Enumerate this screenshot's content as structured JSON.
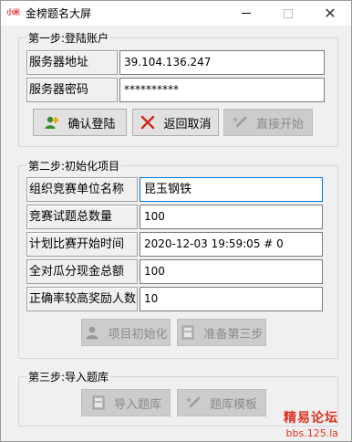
{
  "window": {
    "app_icon_text": "小米",
    "title": "金榜题名大屏"
  },
  "step1": {
    "title": "第一步:登陆账户",
    "server_address_label": "服务器地址",
    "server_address_value": "39.104.136.247",
    "server_password_label": "服务器密码",
    "server_password_value": "**********",
    "confirm_login_label": "确认登陆",
    "cancel_label": "返回取消",
    "direct_start_label": "直接开始"
  },
  "step2": {
    "title": "第二步:初始化项目",
    "org_unit_label": "组织竞赛单位名称",
    "org_unit_value": "昆玉钢铁",
    "question_total_label": "竞赛试题总数量",
    "question_total_value": "100",
    "start_time_label": "计划比赛开始时间",
    "start_time_value": "2020-12-03 19:59:05 # 0",
    "cash_total_label": "全对瓜分现金总额",
    "cash_total_value": "100",
    "reward_count_label": "正确率较高奖励人数",
    "reward_count_value": "10",
    "init_project_label": "项目初始化",
    "prepare_step3_label": "准备第三步"
  },
  "step3": {
    "title": "第三步:导入题库",
    "import_label": "导入题库",
    "template_label": "题库模板"
  },
  "watermark": {
    "line1": "精易论坛",
    "line2": "bbs.125.la"
  },
  "colors": {
    "focus_border": "#0078d7",
    "watermark": "#e0301e",
    "cancel_x": "#cc2a1e",
    "confirm_icon": "#3a8a2e"
  }
}
